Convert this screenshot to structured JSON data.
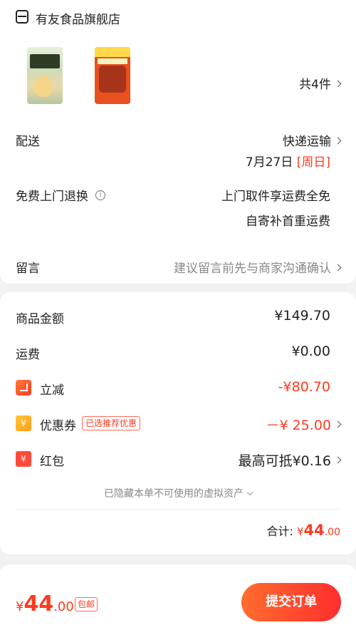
{
  "store": {
    "name": "有友食品旗舰店"
  },
  "products": {
    "count_label": "共4件"
  },
  "delivery": {
    "label": "配送",
    "method": "快递运输",
    "date": "7月27日",
    "weekday": "[周日]"
  },
  "return_service": {
    "label": "免费上门退换",
    "line1": "上门取件享运费全免",
    "line2": "自寄补首重运费"
  },
  "message": {
    "label": "留言",
    "placeholder": "建议留言前先与商家沟通确认"
  },
  "price": {
    "goods_label": "商品金额",
    "goods_value": "¥149.70",
    "shipping_label": "运费",
    "shipping_value": "¥0.00",
    "discount_label": "立减",
    "discount_value": "-¥80.70",
    "coupon_label": "优惠券",
    "coupon_badge": "已选推荐优惠",
    "coupon_value": "－¥ 25.00",
    "redpacket_label": "红包",
    "redpacket_value": "最高可抵¥0.16",
    "hidden_assets": "已隐藏本单不可使用的虚拟资产",
    "total_label": "合计:",
    "total_symbol": "¥",
    "total_int": "44",
    "total_dec": ".00"
  },
  "bottom": {
    "symbol": "¥",
    "amount_int": "44",
    "amount_dec": ".00",
    "free_shipping": "包邮",
    "submit": "提交订单"
  },
  "icons": {
    "coupon_glyph": "¥",
    "redpacket_glyph": "¥"
  },
  "colors": {
    "accent": "#ff3a20",
    "button_start": "#ff6d2e",
    "button_end": "#ff2e2e"
  }
}
